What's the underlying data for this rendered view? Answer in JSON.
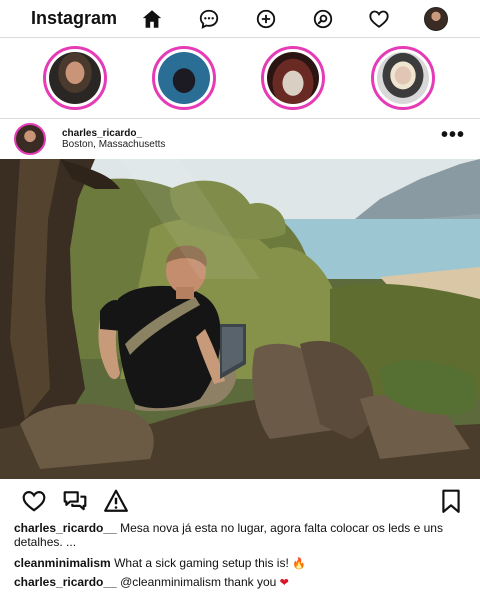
{
  "app": {
    "name": "Instagram"
  },
  "nav": {
    "items": [
      {
        "name": "home-icon"
      },
      {
        "name": "messenger-icon"
      },
      {
        "name": "new-post-icon"
      },
      {
        "name": "explore-icon"
      },
      {
        "name": "activity-icon"
      }
    ]
  },
  "stories": [
    {
      "name": "story-1"
    },
    {
      "name": "story-2"
    },
    {
      "name": "story-3"
    },
    {
      "name": "story-4"
    }
  ],
  "post": {
    "username": "charles_ricardo_",
    "location": "Boston, Massachusetts",
    "more_label": "•••",
    "caption": {
      "username": "charles_ricardo__",
      "text": "Mesa nova já esta no lugar, agora falta colocar os leds e uns detalhes. ..."
    },
    "comments": [
      {
        "username": "cleanminimalism",
        "text": "What a sick gaming setup this is!",
        "emoji": "🔥"
      },
      {
        "username": "charles_ricardo__",
        "text": "@cleanminimalism thank you",
        "emoji": "❤"
      }
    ]
  },
  "colors": {
    "story_ring": "#e63bb6",
    "border": "#dbdbdb",
    "heart": "#d8162b"
  }
}
